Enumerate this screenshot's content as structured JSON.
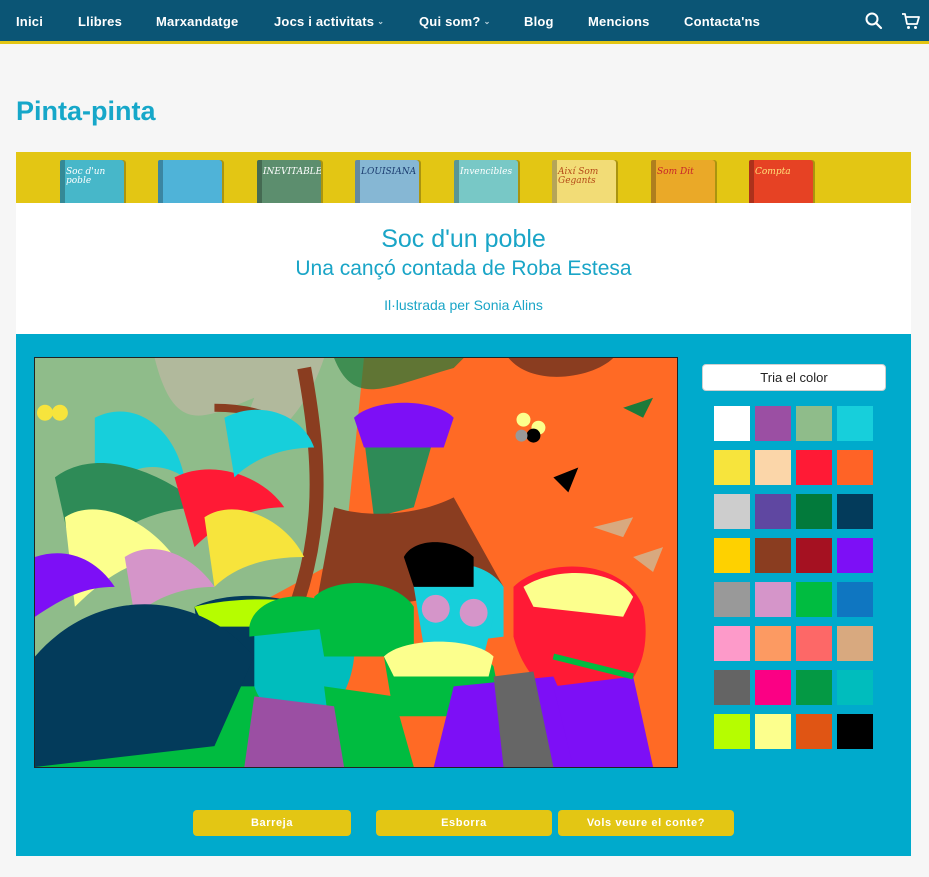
{
  "nav": {
    "items": [
      {
        "label": "Inici",
        "caret": false
      },
      {
        "label": "Llibres",
        "caret": false
      },
      {
        "label": "Marxandatge",
        "caret": false
      },
      {
        "label": "Jocs i activitats",
        "caret": true
      },
      {
        "label": "Qui som?",
        "caret": true
      },
      {
        "label": "Blog",
        "caret": false
      },
      {
        "label": "Mencions",
        "caret": false
      },
      {
        "label": "Contacta'ns",
        "caret": false
      }
    ],
    "icons": [
      "search-icon",
      "cart-icon"
    ]
  },
  "page_title": "Pinta-pinta",
  "banner": {
    "books": [
      {
        "title": "Soc d'un poble",
        "color": "#47b7c9",
        "text_color": "#ffffff"
      },
      {
        "title": "",
        "color": "#4fb3d8",
        "text_color": "#ffffff"
      },
      {
        "title": "INEVITABLE",
        "color": "#5c8e6e",
        "text_color": "#ffffff"
      },
      {
        "title": "LOUISIANA",
        "color": "#86b7d4",
        "text_color": "#1b3c6f"
      },
      {
        "title": "Invencibles",
        "color": "#78c8c6",
        "text_color": "#ffffff"
      },
      {
        "title": "Així Som Gegants",
        "color": "#f2dc76",
        "text_color": "#b44a17"
      },
      {
        "title": "Som Dit",
        "color": "#eaa928",
        "text_color": "#c8252a"
      },
      {
        "title": "Compta",
        "color": "#e64224",
        "text_color": "#ffe27a"
      }
    ]
  },
  "heading": {
    "title": "Soc d'un poble",
    "subtitle": "Una cançó contada de Roba Estesa",
    "credit": "Il·lustrada per Sonia Alins"
  },
  "palette": {
    "button_label": "Tria el color",
    "colors": [
      "#ffffff",
      "#9b4fa3",
      "#8fbc8a",
      "#17cfdb",
      "#f7e43c",
      "#fbd6a9",
      "#ff1a35",
      "#ff6326",
      "#cdcdcd",
      "#5f47a1",
      "#027a3b",
      "#033b5b",
      "#fed100",
      "#8a3d20",
      "#a51121",
      "#7d0ff6",
      "#999999",
      "#d595c9",
      "#00bc40",
      "#0f76c1",
      "#fd9ac9",
      "#fc9a62",
      "#fd6867",
      "#d8a97f",
      "#646464",
      "#fb0084",
      "#049944",
      "#00bdbd",
      "#b6fd00",
      "#fcff8d",
      "#e05514",
      "#000000"
    ]
  },
  "actions": {
    "shuffle": "Barreja",
    "erase": "Esborra",
    "story": "Vols veure el conte?"
  }
}
